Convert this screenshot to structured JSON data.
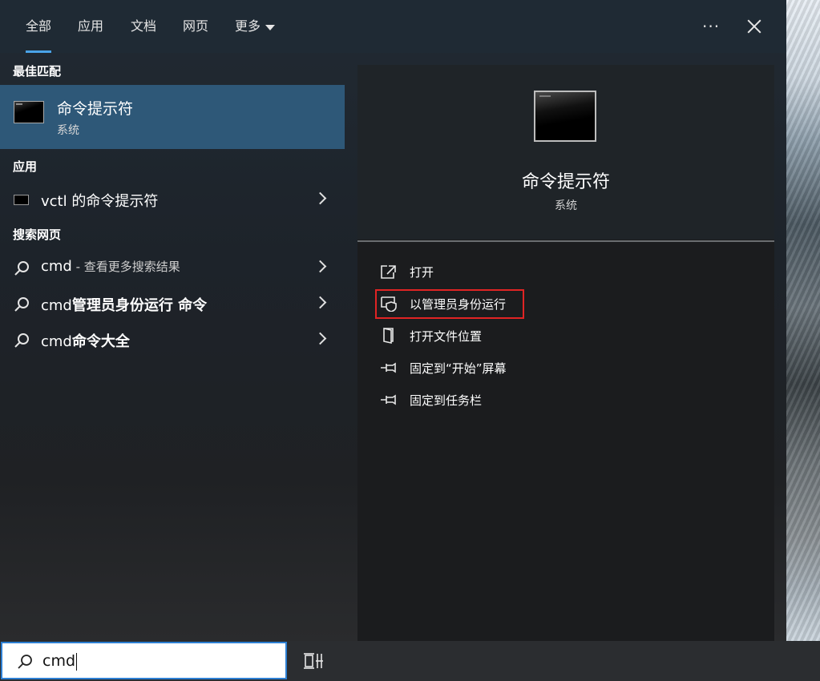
{
  "tabs": [
    {
      "label": "全部",
      "active": true
    },
    {
      "label": "应用"
    },
    {
      "label": "文档"
    },
    {
      "label": "网页"
    },
    {
      "label": "更多"
    }
  ],
  "header": {
    "more_icon": "ellipsis-icon",
    "close_icon": "close-icon"
  },
  "left": {
    "best_match_title": "最佳匹配",
    "best_match": {
      "name": "命令提示符",
      "type": "系统",
      "icon": "command-prompt-icon"
    },
    "apps_title": "应用",
    "apps": [
      {
        "label": "vctl 的命令提示符",
        "icon": "command-prompt-icon"
      }
    ],
    "web_title": "搜索网页",
    "web": [
      {
        "prefix": "cmd",
        "suffix": " - 查看更多搜索结果"
      },
      {
        "prefix": "cmd",
        "bold": "管理员身份运行 命令"
      },
      {
        "prefix": "cmd",
        "bold": "命令大全"
      }
    ]
  },
  "right": {
    "app_name": "命令提示符",
    "app_type": "系统",
    "actions": [
      {
        "label": "打开",
        "icon": "open-icon"
      },
      {
        "label": "以管理员身份运行",
        "icon": "shield-icon",
        "highlighted": true
      },
      {
        "label": "打开文件位置",
        "icon": "folder-icon"
      },
      {
        "label": "固定到“开始”屏幕",
        "icon": "pin-icon"
      },
      {
        "label": "固定到任务栏",
        "icon": "pin-icon"
      }
    ]
  },
  "taskbar": {
    "search_value": "cmd",
    "task_view_icon": "task-view-icon"
  },
  "colors": {
    "accent": "#2d7fd3",
    "selected": "#2e5878",
    "highlight_box": "#e02424"
  }
}
